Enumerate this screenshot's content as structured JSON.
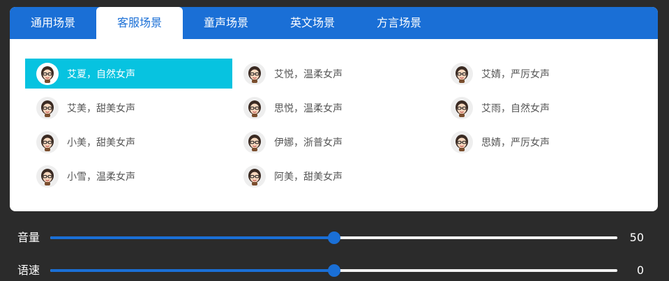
{
  "tabs": [
    {
      "label": "通用场景",
      "active": false
    },
    {
      "label": "客服场景",
      "active": true
    },
    {
      "label": "童声场景",
      "active": false
    },
    {
      "label": "英文场景",
      "active": false
    },
    {
      "label": "方言场景",
      "active": false
    }
  ],
  "voices": [
    {
      "label": "艾夏，自然女声",
      "selected": true
    },
    {
      "label": "艾悦，温柔女声",
      "selected": false
    },
    {
      "label": "艾婧，严厉女声",
      "selected": false
    },
    {
      "label": "艾美，甜美女声",
      "selected": false
    },
    {
      "label": "思悦，温柔女声",
      "selected": false
    },
    {
      "label": "艾雨，自然女声",
      "selected": false
    },
    {
      "label": "小美，甜美女声",
      "selected": false
    },
    {
      "label": "伊娜，浙普女声",
      "selected": false
    },
    {
      "label": "思婧，严厉女声",
      "selected": false
    },
    {
      "label": "小雪，温柔女声",
      "selected": false
    },
    {
      "label": "阿美，甜美女声",
      "selected": false
    }
  ],
  "volume": {
    "label": "音量",
    "value": "50",
    "fraction": 0.5
  },
  "speed": {
    "label": "语速",
    "value": "0",
    "fraction": 0.5
  },
  "colors": {
    "accent": "#1a6fd6",
    "selected": "#07c3e0",
    "background": "#2b2b2b"
  },
  "icons": {
    "avatar": "girl-avatar-icon"
  }
}
